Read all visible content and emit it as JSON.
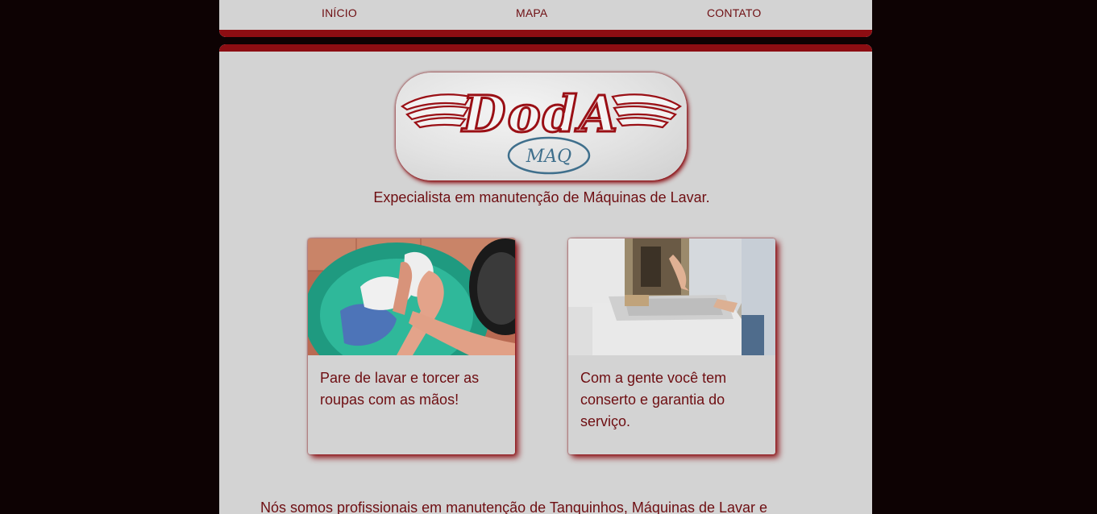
{
  "nav": {
    "items": [
      {
        "label": "INÍCIO"
      },
      {
        "label": "MAPA"
      },
      {
        "label": "CONTATO"
      }
    ]
  },
  "logo": {
    "brand": "DodA",
    "sub": "MAQ"
  },
  "tagline": "Expecialista em manutenção de Máquinas de Lavar.",
  "cards": [
    {
      "text": "Pare de lavar e torcer as roupas com as mãos!",
      "image": "hand-washing-basin-photo"
    },
    {
      "text": "Com a gente você tem conserto e garantia do serviço.",
      "image": "washing-machine-repair-photo"
    }
  ],
  "intro": "Nós somos profissionais em manutenção de Tanquinhos, Máquinas de Lavar e",
  "colors": {
    "accent": "#8c0d12",
    "text": "#6e0e12",
    "panel": "#d3d3d3",
    "background": "#0d0203"
  }
}
